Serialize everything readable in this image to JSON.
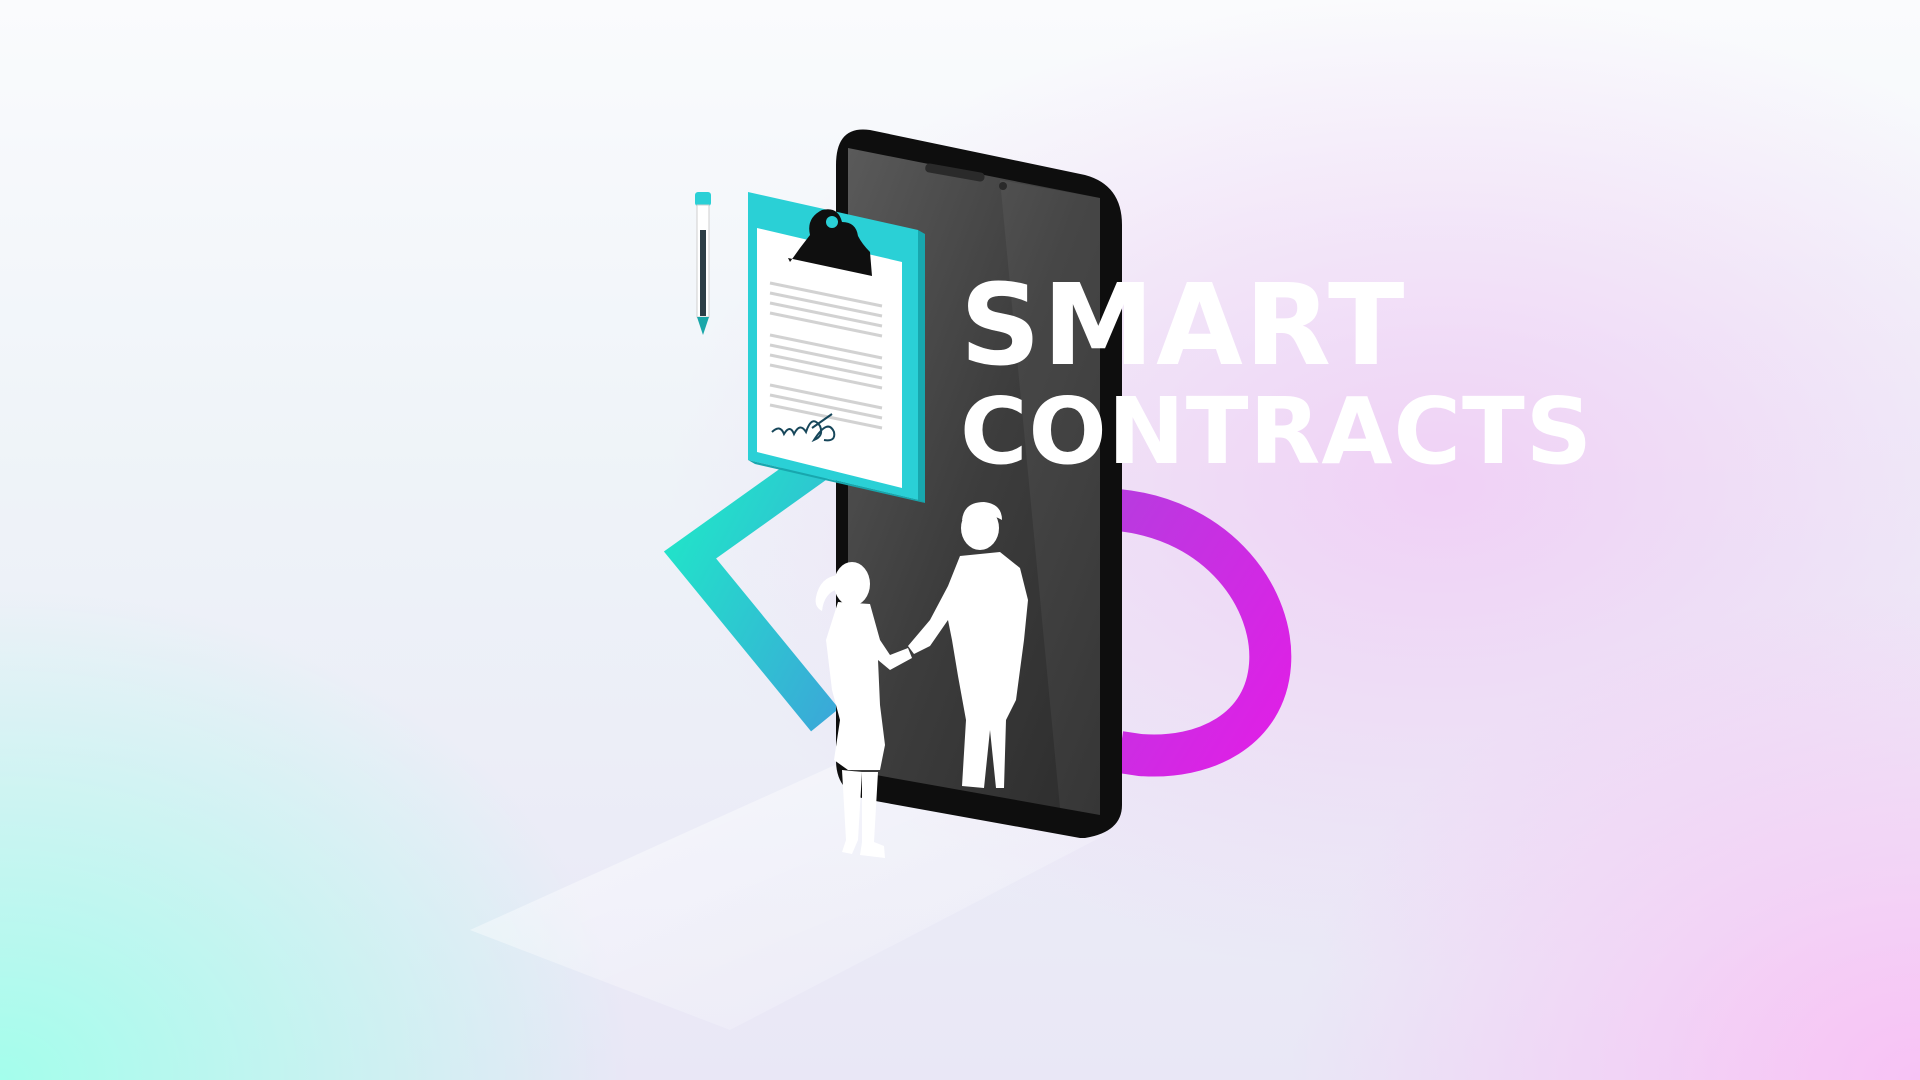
{
  "headline": {
    "line1": "SMART",
    "line2": "CONTRACTS"
  },
  "colors": {
    "teal_accent": "#1fe3c6",
    "magenta_accent": "#d61ee6",
    "clipboard": "#2ad0d6",
    "phone_body": "#111111",
    "phone_screen": "#3a3a3a",
    "figures": "#ffffff"
  },
  "icons": [
    "clipboard-icon",
    "pen-icon",
    "smartphone-icon",
    "handshake-icon",
    "signature-icon"
  ]
}
